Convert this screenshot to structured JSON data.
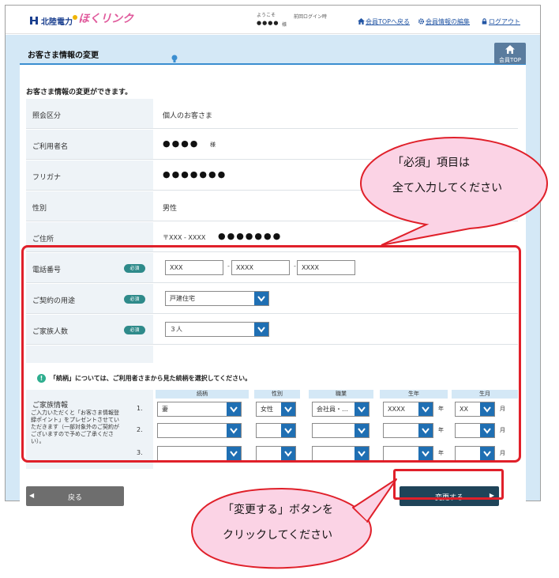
{
  "header": {
    "logo_company": "北陸電力",
    "logo_service": "ほくリンク",
    "welcome_label": "ようこそ",
    "welcome_name": "●●●●",
    "welcome_suffix": "様",
    "last_login_label": "前回ログイン時",
    "links": {
      "member_top": "会員TOPへ戻る",
      "edit_info": "会員情報の編集",
      "logout": "ログアウト"
    }
  },
  "page": {
    "title": "お客さま情報の変更",
    "top_button_label": "会員TOP",
    "intro": "お客さま情報の変更ができます。"
  },
  "fields": {
    "inquiry_type": {
      "label": "照会区分",
      "value": "個人のお客さま"
    },
    "user_name": {
      "label": "ご利用者名",
      "value": "●●●●",
      "suffix": "様"
    },
    "furigana": {
      "label": "フリガナ",
      "value": "●●●●●●●"
    },
    "gender": {
      "label": "性別",
      "value": "男性"
    },
    "address": {
      "label": "ご住所",
      "postal": "〒XXX - XXXX",
      "value": "●●●●●●●"
    },
    "phone": {
      "label": "電話番号",
      "part1": "XXX",
      "part2": "XXXX",
      "part3": "XXXX",
      "separator": "-"
    },
    "contract_use": {
      "label": "ご契約の用途",
      "value": "戸建住宅"
    },
    "family_count": {
      "label": "ご家族人数",
      "value": "３人"
    }
  },
  "required_badge": "必須",
  "notice": {
    "icon": "!",
    "text": "「続柄」については、ご利用者さまから見た続柄を選択してください。"
  },
  "family": {
    "label": "ご家族情報",
    "description": "ご入力いただくと「お客さま情報登録ポイント」をプレゼントさせていただきます（一部対象外のご契約がございますので予めご了承ください）。",
    "columns": [
      "続柄",
      "性別",
      "職業",
      "生年",
      "生月"
    ],
    "year_unit": "年",
    "month_unit": "月",
    "rows": [
      {
        "num": "1.",
        "relation": "妻",
        "gender": "女性",
        "occupation": "会社員・…",
        "birth_year": "XXXX",
        "birth_month": "XX"
      },
      {
        "num": "2.",
        "relation": "",
        "gender": "",
        "occupation": "",
        "birth_year": "",
        "birth_month": ""
      },
      {
        "num": "3.",
        "relation": "",
        "gender": "",
        "occupation": "",
        "birth_year": "",
        "birth_month": ""
      }
    ]
  },
  "buttons": {
    "back": "戻る",
    "change": "変更する"
  },
  "annotations": {
    "required_bubble_line1": "「必須」項目は",
    "required_bubble_line2": "全て入力してください",
    "button_bubble_line1": "「変更する」ボタンを",
    "button_bubble_line2": "クリックしてください"
  },
  "colors": {
    "accent_blue": "#1f6fb3",
    "required_badge": "#2e8a8a",
    "highlight_red": "#e0202a",
    "bubble_pink": "#fbd3e5"
  }
}
